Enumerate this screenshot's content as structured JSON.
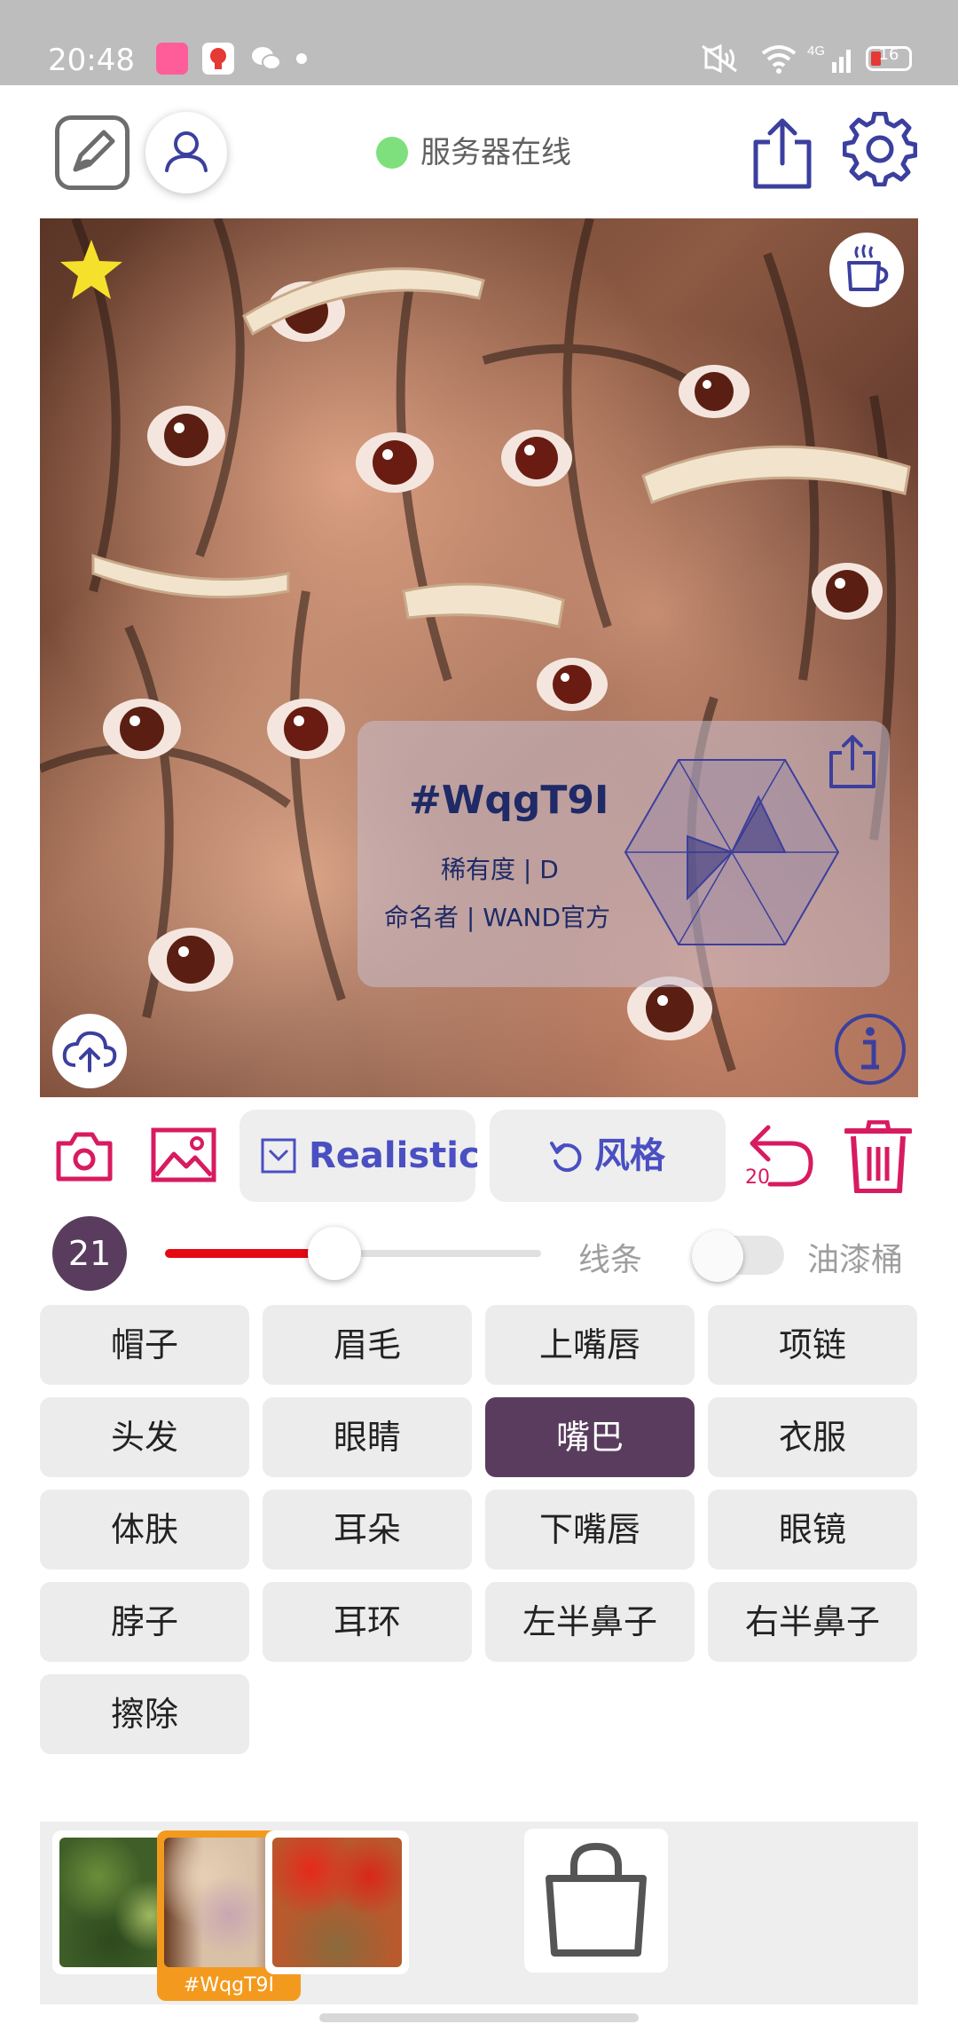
{
  "status_bar": {
    "time": "20:48",
    "network_label": "4G",
    "battery_level": "16",
    "icons": [
      "cartoon-app-icon",
      "red-app-icon",
      "wechat-icon",
      "mute-icon",
      "wifi-icon",
      "signal-icon",
      "battery-icon"
    ]
  },
  "toolbar": {
    "server_status": "服务器在线",
    "server_status_color": "#7de07d",
    "icons": [
      "edit-icon",
      "profile-icon",
      "share-icon",
      "settings-icon"
    ]
  },
  "canvas": {
    "card": {
      "id": "#WqgT9I",
      "rarity": "稀有度 | D",
      "namer": "命名者 | WAND官方"
    },
    "icons": [
      "star-icon",
      "coffee-icon",
      "upload-cloud-icon",
      "info-icon",
      "radar-chart",
      "card-share-icon"
    ]
  },
  "controls": {
    "realistic_label": "Realistic",
    "style_label": "风格",
    "undo_count": "20",
    "accent_color": "#4a4fc2",
    "danger_color": "#d81b60"
  },
  "brush": {
    "size": "21",
    "slider_fraction": 0.45,
    "line_label": "线条",
    "bucket_label": "油漆桶",
    "bucket_enabled": false
  },
  "parts": [
    {
      "label": "帽子",
      "active": false
    },
    {
      "label": "眉毛",
      "active": false
    },
    {
      "label": "上嘴唇",
      "active": false
    },
    {
      "label": "项链",
      "active": false
    },
    {
      "label": "头发",
      "active": false
    },
    {
      "label": "眼睛",
      "active": false
    },
    {
      "label": "嘴巴",
      "active": true
    },
    {
      "label": "衣服",
      "active": false
    },
    {
      "label": "体肤",
      "active": false
    },
    {
      "label": "耳朵",
      "active": false
    },
    {
      "label": "下嘴唇",
      "active": false
    },
    {
      "label": "眼镜",
      "active": false
    },
    {
      "label": "脖子",
      "active": false
    },
    {
      "label": "耳环",
      "active": false
    },
    {
      "label": "左半鼻子",
      "active": false
    },
    {
      "label": "右半鼻子",
      "active": false
    },
    {
      "label": "擦除",
      "active": false
    }
  ],
  "styles": {
    "selected_caption": "#WqgT9I",
    "shop_icon": "shopping-bag-icon"
  }
}
